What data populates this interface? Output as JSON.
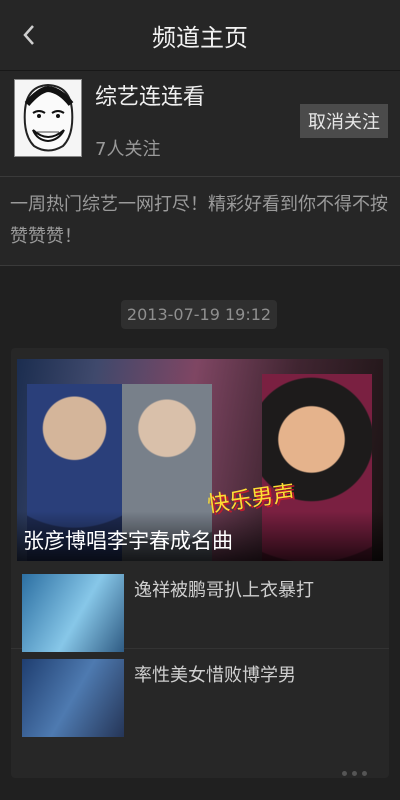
{
  "header": {
    "title": "频道主页",
    "back_icon": "back-arrow-icon"
  },
  "profile": {
    "name": "综艺连连看",
    "followers": "7人关注",
    "unfollow_label": "取消关注"
  },
  "description": "一周热门综艺一网打尽！精彩好看到你不得不按赞赞赞！",
  "feed": {
    "timestamp": "2013-07-19 19:12",
    "featured": {
      "title": "张彦博唱李宇春成名曲",
      "logo_text": "快乐男声"
    },
    "items": [
      {
        "title": "逸祥被鹏哥扒上衣暴打"
      },
      {
        "title": "率性美女惜败博学男"
      }
    ],
    "more_icon": "more-dots-icon"
  }
}
